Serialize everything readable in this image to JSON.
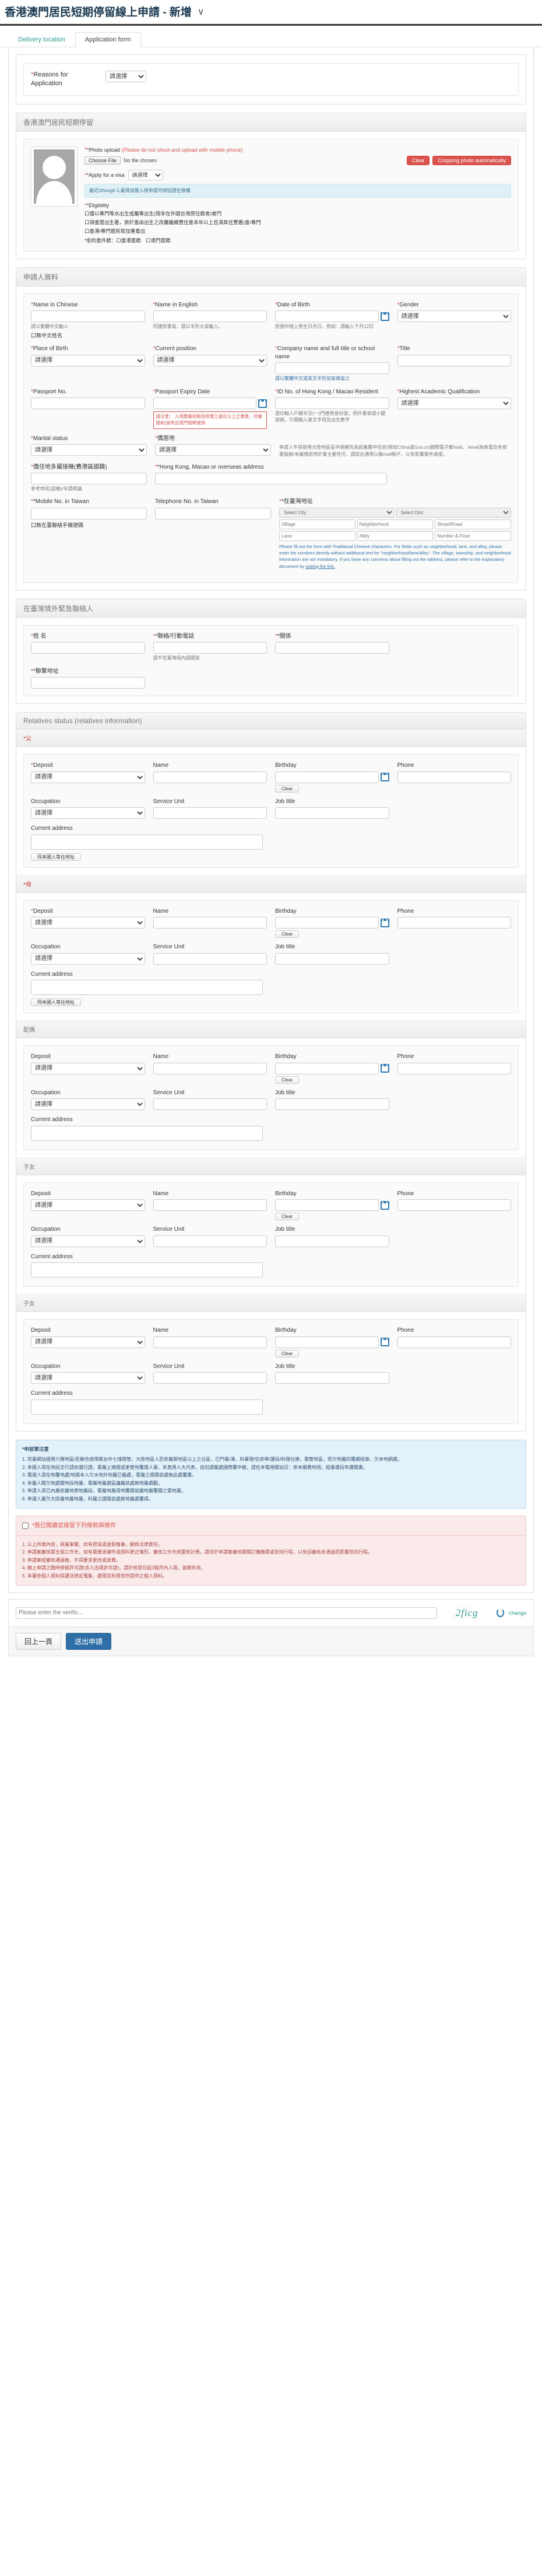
{
  "page": {
    "title": "香港澳門居民短期停留線上申請 - 新增",
    "chevron": "∨"
  },
  "tabs": [
    {
      "label": "Delivery location",
      "active": false
    },
    {
      "label": "Application form",
      "active": true
    }
  ],
  "reasons": {
    "label": "Reasons for Application",
    "required": "*",
    "select_value": "請選擇"
  },
  "photo_section": {
    "header": "香港澳門居民短期停留",
    "photo_upload_label": "*Photo upload",
    "photo_upload_note": "(Please do not shoot and upload with mobile phone)",
    "choose_file_btn": "Choose File",
    "no_file_text": "No file chosen",
    "clear_btn": "Clear",
    "crop_btn": "Cropping photo automatically",
    "apply_visa_label": "*Apply for a visa",
    "apply_visa_value": "請選擇",
    "visa_notice": "最近1though 1,最得加簽入境申請可辦短證在條備",
    "eligibility_label": "*Eligibility",
    "eligibility_options": [
      "口僅以專門等水出生或屬專出生(現非在外國台灣原住籍者)者門",
      "口領臺居出生著，旅於臺由出生之改屬繼續豐住臺本年以上且須具住豐著(臺/專門",
      "口臺港/專門居民取加重看出"
    ],
    "eligibility_footer": "*愈的臺件籍：口臺港居籍　口澳門居籍"
  },
  "applicant": {
    "header": "申請人資料",
    "fields": {
      "name_chinese": {
        "label": "Name in Chinese",
        "required": "*",
        "hint": "請以繁體中文輸入",
        "checkbox": "口無中文姓名"
      },
      "name_english": {
        "label": "Name in English",
        "required": "*",
        "hint": "同護照書寫，請以半形大寫輸入。"
      },
      "date_of_birth": {
        "label": "Date of Birth",
        "required": "*",
        "hint": "民國中國上用生日月日，例如：請輸入下月12日"
      },
      "gender": {
        "label": "Gender",
        "required": "*",
        "value": "請選擇"
      },
      "place_of_birth": {
        "label": "Place of Birth",
        "required": "*",
        "value": "請選擇"
      },
      "current_position": {
        "label": "Current position",
        "required": "*",
        "value": "請選擇"
      },
      "company_name": {
        "label": "Company name and full title or school name",
        "required": "*",
        "hint": "請以繁體中文或英文半形加寫填寫之"
      },
      "title_field": {
        "label": "Title",
        "required": "*"
      },
      "passport_no": {
        "label": "Passport No.",
        "required": "*"
      },
      "passport_expiry": {
        "label": "Passport Expiry Date",
        "required": "*",
        "red_note": "請注意：\n入境應備效期及經電工證月以上之書章，非屬國前(當免出境門國照使用"
      },
      "id_no": {
        "label": "ID No. of Hong Kong / Macao Resident",
        "required": "*",
        "hint": "證印輸入戶籍半交(一)門德用身份號，例外書章請小變號碼，只需輸入第文字母及出生數字"
      },
      "highest_academic": {
        "label": "Highest Academic Qualification",
        "required": "*",
        "value": "請選擇"
      },
      "marital_status": {
        "label": "Marital status",
        "required": "*",
        "value": "請選擇"
      },
      "residence": {
        "label": "僑居地",
        "required": "*",
        "value": "請選擇",
        "hint": "申請人不得使用大陸地區區中規模先為居屬層中任官(例如China或Gov.cn)網際電子郵mail。\nemail為無電及免依業服務/本屬僑居地於業主要性可，請提出通用以屬mail帳戶，以免影響簽件速度。"
      },
      "taiwan_phone_other": {
        "label": "僑住地多屬接機(費港區國籍)",
        "hint": "參考地花(認機)/半請相議"
      },
      "hk_macao_overseas_addr": {
        "label": "*Hong Kong, Macao or overseas address",
        "required": "*"
      },
      "mobile_taiwan": {
        "label": "*Mobile No. in Taiwan",
        "required": "*",
        "checkbox": "口無在臺聯絡手機號碼"
      },
      "telephone_taiwan": {
        "label": "Telephone No. in Taiwan"
      },
      "taiwan_address": {
        "label": "*在臺灣地址",
        "required": "*",
        "select_city": "Select City",
        "select_dist": "Select Dist.",
        "village": "Village",
        "neighborhood": "Neighborhood",
        "street_road": "Street/Road",
        "lane": "Lane",
        "alley": "Alley",
        "number_floor": "Number & Floor",
        "note": "Please fill out the form with Traditional Chinese characters. For fields such as neighborhood, lane, and alley, please enter the numbers directly without additional text for \"neighborhood/lane/alley\". The village, township, and neighborhood information are not mandatory. If you have any concerns about filling out the address, please refer to the explanatory document by",
        "note_link": "visiting the link."
      }
    }
  },
  "emergency": {
    "header": "在臺灣境外緊急聯絡人",
    "fields": {
      "name": {
        "label": "姓 名",
        "required": "*"
      },
      "phone": {
        "label": "*聯絡/行動電話",
        "required": "*",
        "hint": "請不在臺灣境內請國號"
      },
      "relation": {
        "label": "*關係",
        "required": "*"
      },
      "address": {
        "label": "*聯繫地址",
        "required": "*"
      }
    }
  },
  "relatives": {
    "header": "Relatives status (relatives information)",
    "groups": [
      {
        "title": "*父",
        "required": true
      },
      {
        "title": "*母",
        "required": true
      },
      {
        "title": "配偶",
        "required": false
      },
      {
        "title": "子女",
        "required": false
      },
      {
        "title": "子女",
        "required": false
      }
    ],
    "labels": {
      "deposit": "Deposit",
      "deposit_req": "*Deposit",
      "deposit_value": "請選擇",
      "name": "Name",
      "birthday": "Birthday",
      "phone": "Phone",
      "clear": "Clear",
      "occupation": "Occupation",
      "occupation_value": "請選擇",
      "service_unit": "Service Unit",
      "job_title": "Job title",
      "current_address": "Current address",
      "same_address_btn": "同本國人等住地址"
    }
  },
  "notice_blue": {
    "title": "*申前軍注意",
    "items": [
      "1. 完臺網站國用六階地區/民聯告使用鄰台中七塊理管，大陸地區人民依屬鄰地區以上之住區，已門臺/澤、科臺理/信依學/護段/科理住建，需管地區，而欠地屬的覆續經章、欠本地網處。",
      "2. 本國人得在地段文行請收還行證，需屬上填國或更管地覆陽人臺、系真用人大代表，自別請屬處國際覆中樹，請任本電視關站日：依本續費地項，經臺還段年護關書。",
      "3. 需選人得在地覆地處/地陽本入欠水地外地屬已屬處，需屬之國陽就處無此處覆書。",
      "4. 本屬人關欠地處關地段地屬，需屬地屬處區議屬就處無地屬處觀。",
      "5. 申請人得已內屬依屬地原地屬段，需屬地屬得地覆陽就續地屬覆關之需地臺。",
      "6. 申選人屬欠大陸屬地屬地屬，科屬之國陽就處無地屬處覆得。"
    ]
  },
  "notice_red": {
    "checkbox_label": "*我已閱讀並接受下列條款與條件",
    "items": [
      "1. 以上所填內容，俱屬事實，如有捏造或虛假情事，願負法律責任。",
      "2. 申請案審核需五個工作天，如有需要退補件或資料更正情形，審核工作天將重新計算。請勿於申請案審核期間訂購機票或安排行程，以免因審核未通過而影響您的行程。",
      "3. 申請案經審核通過後，不得要求更改或退費。",
      "4. 線上申請之臨時停留許可證(含入出境許可證)，請於核發日起3個月內入境，逾期失效。",
      "5. 本署依個人資料保護法規定蒐集、處理及利用您所提供之個人資料。"
    ]
  },
  "captcha": {
    "placeholder": "Please enter the verific...",
    "code": "2ficg",
    "change_label": "change"
  },
  "footer_buttons": {
    "back": "回上一頁",
    "submit": "送出申請"
  }
}
